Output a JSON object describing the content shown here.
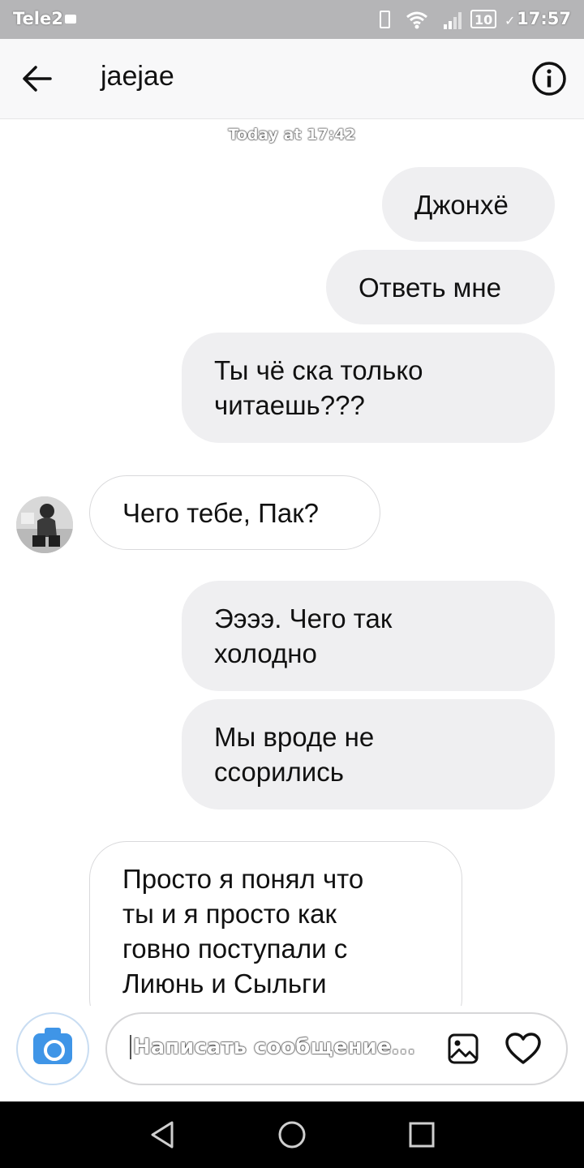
{
  "status_bar": {
    "carrier": "Tele2",
    "battery": "10",
    "time": "17:57"
  },
  "header": {
    "title": "jaejae",
    "back_icon": "arrow-left-icon",
    "info_icon": "info-icon"
  },
  "day_separator": "Today at 17:42",
  "messages": [
    {
      "direction": "out",
      "text": "Джонхё"
    },
    {
      "direction": "out",
      "text": "Ответь мне"
    },
    {
      "direction": "out",
      "text": "Ты чё ска только\nчитаешь???"
    },
    {
      "direction": "in",
      "text": "Чего тебе, Пак?"
    },
    {
      "direction": "out",
      "text": "Ээээ. Чего так\nхолодно"
    },
    {
      "direction": "out",
      "text": "Мы вроде не\nссорились"
    },
    {
      "direction": "in",
      "text": "Просто я понял что\nты и я просто как\nговно поступали с\nЛиюнь и Сыльги"
    }
  ],
  "composer": {
    "placeholder": "Написать сообщение...",
    "camera_icon": "camera-icon",
    "gallery_icon": "image-icon",
    "like_icon": "heart-icon"
  },
  "colors": {
    "outgoing_bubble": "#efeff1",
    "incoming_border": "#d9d9db",
    "camera_blue": "#3f95e7",
    "status_bar": "#b5b5b7"
  }
}
